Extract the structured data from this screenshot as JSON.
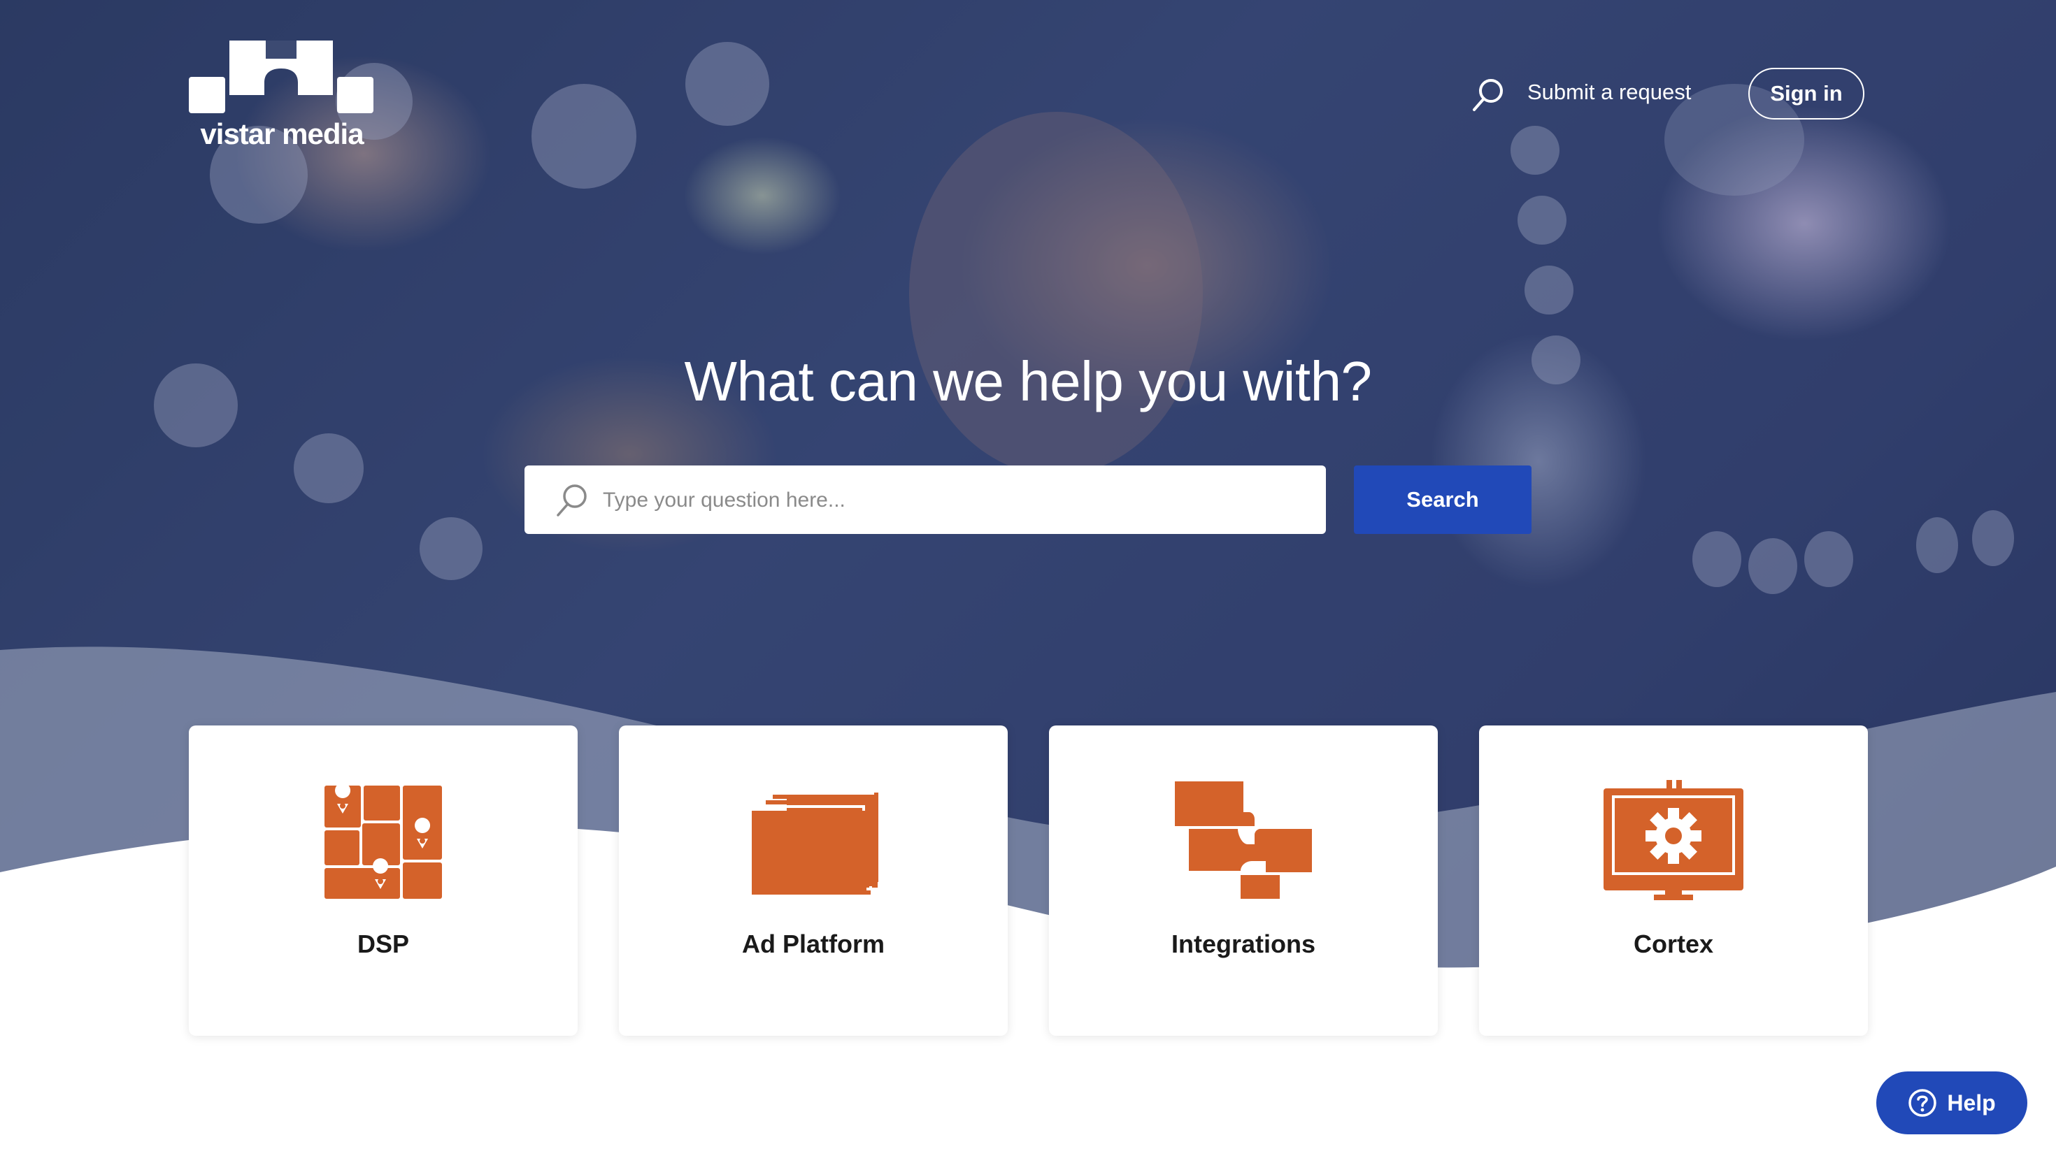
{
  "brand": {
    "name": "vistar media"
  },
  "header": {
    "search_icon": "search-icon",
    "submit_request": "Submit a request",
    "sign_in": "Sign in"
  },
  "hero": {
    "title": "What can we help you with?",
    "search_placeholder": "Type your question here...",
    "search_value": "",
    "search_button": "Search"
  },
  "categories": [
    {
      "label": "DSP",
      "icon": "map-grid-icon"
    },
    {
      "label": "Ad Platform",
      "icon": "stacked-cards-icon"
    },
    {
      "label": "Integrations",
      "icon": "integration-blocks-icon"
    },
    {
      "label": "Cortex",
      "icon": "billboard-gear-icon"
    }
  ],
  "help_widget": {
    "label": "Help",
    "icon": "question-circle-icon"
  },
  "colors": {
    "accent_blue": "#2149b8",
    "icon_orange": "#d4622a",
    "overlay_navy": "#243468",
    "card_bg": "#ffffff"
  }
}
